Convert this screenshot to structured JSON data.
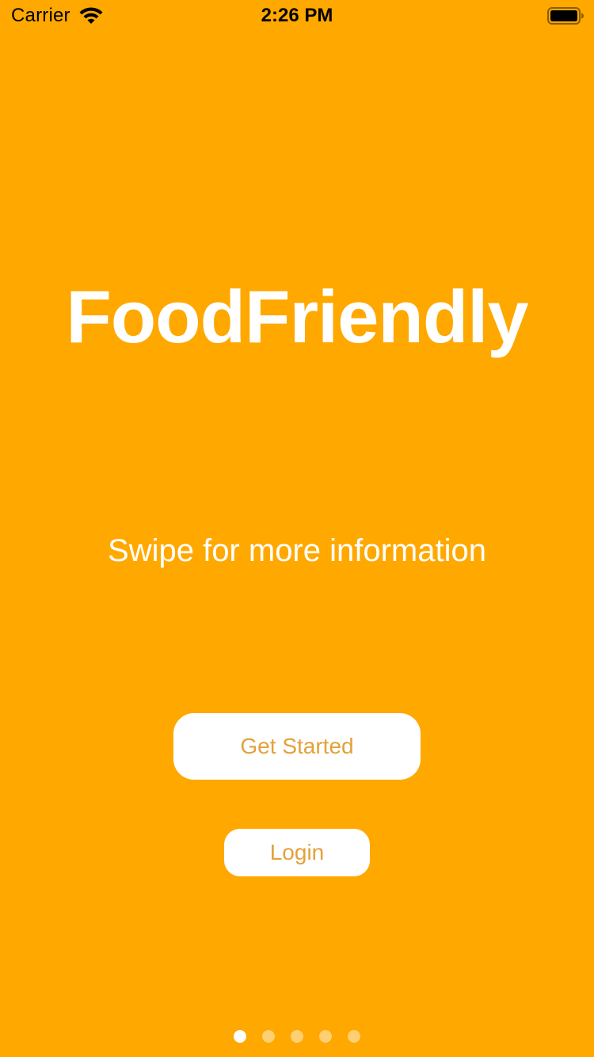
{
  "status_bar": {
    "carrier": "Carrier",
    "time": "2:26 PM",
    "wifi_icon": "wifi-icon",
    "battery_icon": "battery-icon"
  },
  "main": {
    "title": "FoodFriendly",
    "subtitle": "Swipe for more information",
    "get_started_label": "Get Started",
    "login_label": "Login"
  },
  "pager": {
    "page_count": 5,
    "current_page": 1
  },
  "colors": {
    "background": "#FFA800",
    "button_bg": "#FFFFFF",
    "button_text": "#E3A13A",
    "text": "#FFFFFF"
  }
}
